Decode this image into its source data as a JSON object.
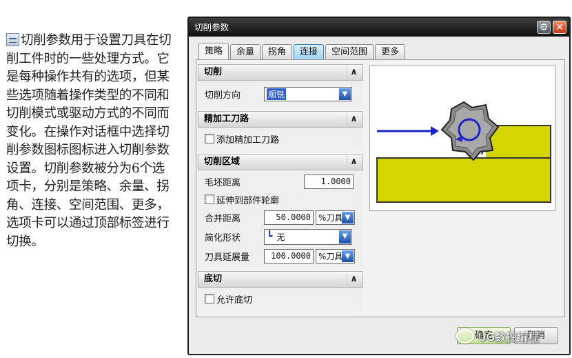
{
  "intro_text": "切削参数用于设置刀具在切削工件时的一些处理方式。它是每种操作共有的选项，但某些选项随着操作类型的不同和切削模式或驱动方式的不同而变化。在操作对话框中选择切削参数图标图标进入切削参数设置。切削参数被分为6个选项卡，分别是策略、余量、拐角、连接、空间范围、更多，选项卡可以通过顶部标签进行切换。",
  "dialog": {
    "title": "切削参数",
    "gear_icon": "⚙",
    "close_icon": "✕",
    "tabs": [
      {
        "label": "策略"
      },
      {
        "label": "余量"
      },
      {
        "label": "拐角"
      },
      {
        "label": "连接"
      },
      {
        "label": "空间范围"
      },
      {
        "label": "更多"
      }
    ],
    "active_tab": "策略",
    "highlighted_tab": "连接"
  },
  "groups": {
    "cut": {
      "title": "切削",
      "direction_label": "切削方向",
      "direction_value": "顺铣"
    },
    "finish": {
      "title": "精加工刀路",
      "add_finish_label": "添加精加工刀路"
    },
    "area": {
      "title": "切削区域",
      "blank_label": "毛坯距离",
      "blank_value": "1.0000",
      "extend_label": "延伸到部件轮廓",
      "merge_label": "合并距离",
      "merge_value": "50.0000",
      "merge_unit": "%刀具",
      "simplify_label": "简化形状",
      "simplify_value": "无",
      "extend_tool_label": "刀具延展量",
      "extend_tool_value": "100.0000",
      "extend_tool_unit": "%刀具"
    },
    "undercut": {
      "title": "底切",
      "allow_label": "允许底切"
    }
  },
  "buttons": {
    "ok": "确定",
    "cancel": "取消"
  },
  "watermark": "UG数控编程",
  "colors": {
    "arrow": "#1a22c8",
    "part": "#d4d400",
    "tool": "#8a8a8a"
  }
}
